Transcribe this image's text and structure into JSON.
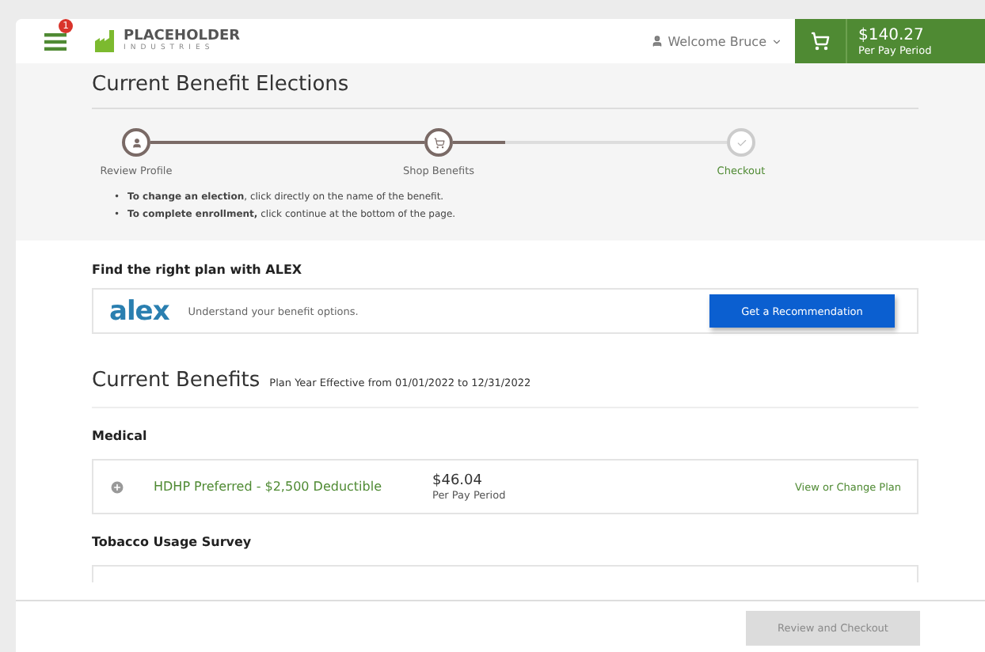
{
  "header": {
    "menu_badge": "1",
    "logo": {
      "line1": "PLACEHOLDER",
      "line2": "INDUSTRIES"
    },
    "user": "Welcome Bruce",
    "cart": {
      "amount": "$140.27",
      "period": "Per Pay Period"
    }
  },
  "title": "Current Benefit Elections",
  "progress": {
    "level": 0.19
  },
  "steps": [
    {
      "label": "Review Profile",
      "done": true
    },
    {
      "label": "Shop Benefits",
      "done": true
    },
    {
      "label": "Checkout",
      "done": false
    }
  ],
  "instructions": [
    {
      "bullet": "•",
      "text": "**To change an election**, click directly on the name of the benefit."
    },
    {
      "bullet": "•",
      "text": "**To complete enrollment,** click continue at the bottom of the page."
    }
  ],
  "alex": {
    "heading": "Find the right plan with ALEX",
    "logo": "alex",
    "text": "Understand your benefit options.",
    "button": "Get a Recommendation"
  },
  "benefits": {
    "title": "Current Benefits",
    "subtitle": "Plan Year Effective from 01/01/2022 to 12/31/2022",
    "sections": [
      {
        "heading": "Medical",
        "plan": "HDHP Preferred - $2,500 Deductible",
        "price": "$46.04",
        "period": "Per Pay Period",
        "link": "View or Change Plan"
      },
      {
        "heading": "Tobacco Usage Survey"
      }
    ]
  },
  "footer": {
    "button": "Review and Checkout",
    "disabled": true
  }
}
